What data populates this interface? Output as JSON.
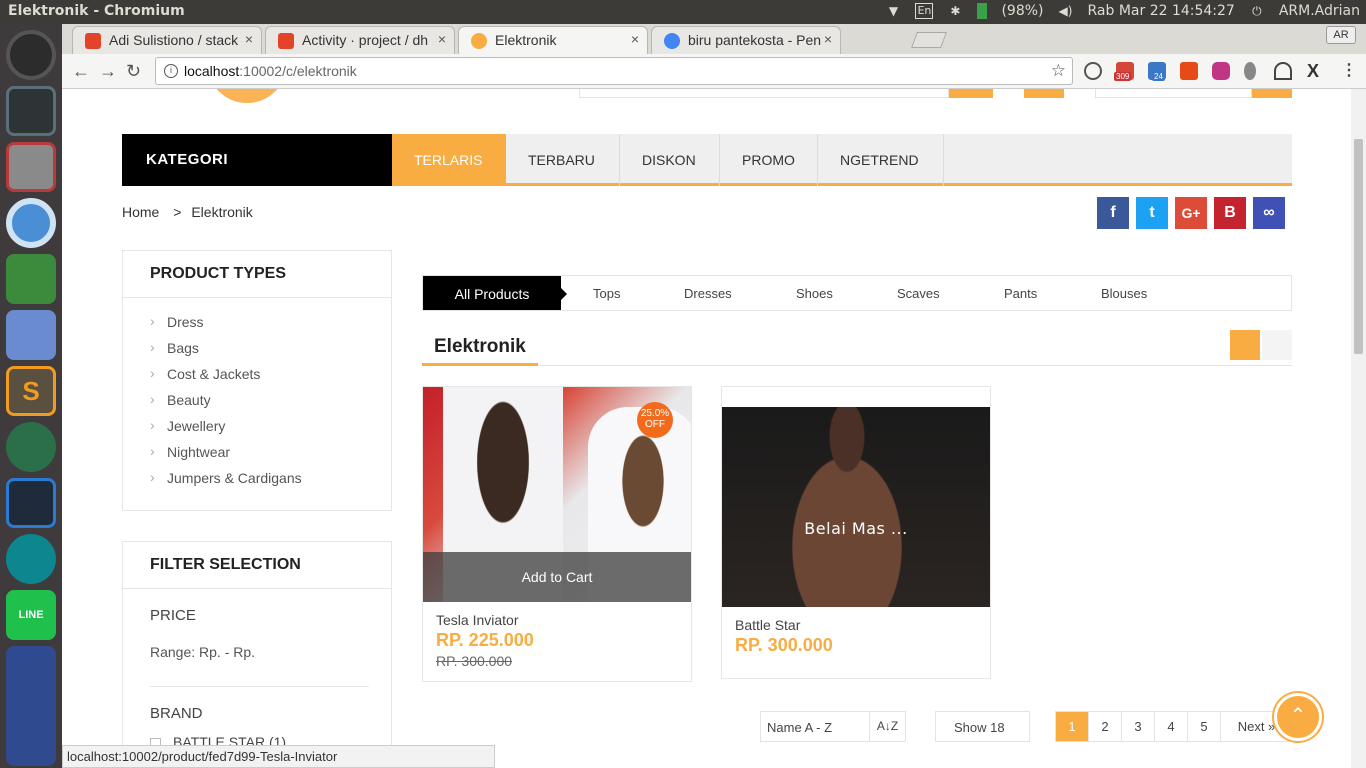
{
  "os": {
    "window_title": "Elektronik - Chromium",
    "battery": "(98%)",
    "clock": "Rab Mar 22 14:54:27",
    "user": "ARM.Adrian",
    "keyboard": "En"
  },
  "browser": {
    "tabs": [
      {
        "label": "Adi Sulistiono / stack",
        "active": false
      },
      {
        "label": "Activity · project / dh",
        "active": false
      },
      {
        "label": "Elektronik",
        "active": true
      },
      {
        "label": "biru pantekosta - Pen",
        "active": false
      }
    ],
    "profile_label": "AR",
    "url_host": "localhost",
    "url_path": ":10002/c/elektronik",
    "ext_badges": {
      "gmail": "309",
      "msg": "24"
    },
    "status_url": "localhost:10002/product/fed7d99-Tesla-Inviator"
  },
  "nav": {
    "category_label": "KATEGORI",
    "items": [
      "TERLARIS",
      "TERBARU",
      "DISKON",
      "PROMO",
      "NGETREND"
    ]
  },
  "breadcrumb": {
    "home": "Home",
    "sep": ">",
    "current": "Elektronik"
  },
  "social": {
    "facebook": "f",
    "twitter": "t",
    "google": "G+",
    "blogger": "B",
    "link": "∞"
  },
  "product_types": {
    "title": "PRODUCT TYPES",
    "items": [
      "Dress",
      "Bags",
      "Cost & Jackets",
      "Beauty",
      "Jewellery",
      "Nightwear",
      "Jumpers & Cardigans"
    ]
  },
  "filter": {
    "title": "FILTER SELECTION",
    "price_label": "PRICE",
    "range": "Range: Rp. - Rp.",
    "brand_label": "BRAND",
    "brand_item": "BATTLE STAR (1)"
  },
  "product_tabs": [
    "All Products",
    "Tops",
    "Dresses",
    "Shoes",
    "Scaves",
    "Pants",
    "Blouses"
  ],
  "section_title": "Elektronik",
  "products": [
    {
      "name": "Tesla Inviator",
      "price": "RP. 225.000",
      "old_price": "RP. 300.000",
      "sale": "25.0% OFF",
      "add_cart": "Add to Cart"
    },
    {
      "name": "Battle Star",
      "price": "RP. 300.000",
      "overlay": "Belai Mas ..."
    }
  ],
  "sort": {
    "value": "Name A - Z",
    "icon": "A↓Z"
  },
  "show": "Show 18",
  "pagination": [
    "1",
    "2",
    "3",
    "4",
    "5"
  ],
  "next_label": "Next »",
  "colors": {
    "accent": "#f9ac42",
    "sale": "#f26b1d"
  }
}
